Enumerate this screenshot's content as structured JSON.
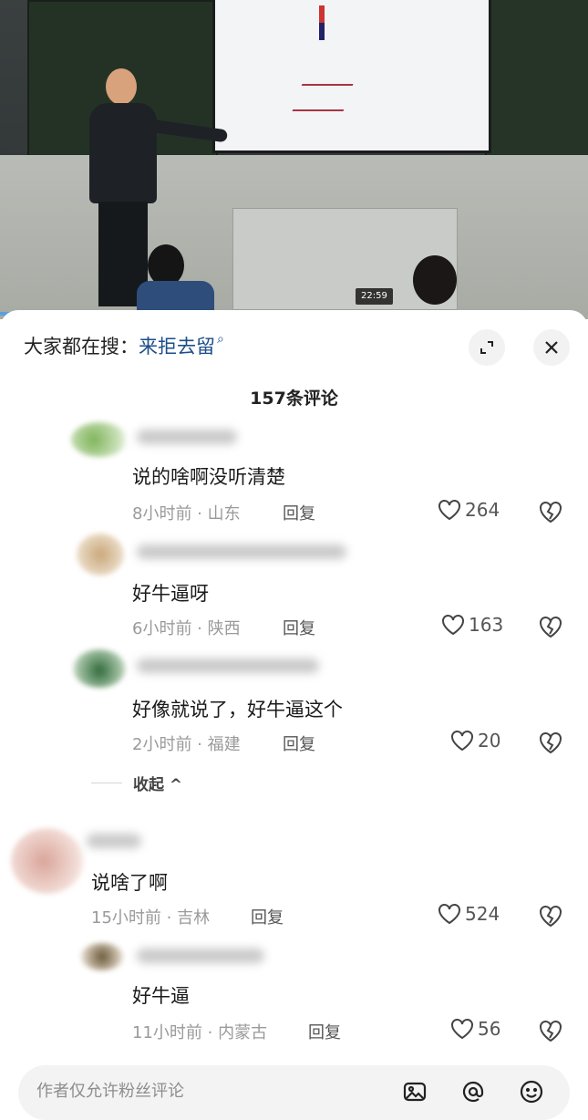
{
  "video": {
    "timestamp": "22:59"
  },
  "sheet": {
    "search_prefix": "大家都在搜：",
    "search_keyword": "来拒去留",
    "comment_count_title": "157条评论",
    "collapse_label": "收起 ^",
    "input_placeholder": "作者仅允许粉丝评论"
  },
  "comments": [
    {
      "text": "说的啥啊没听清楚",
      "meta": "8小时前 · 山东",
      "reply": "回复",
      "likes": "264"
    },
    {
      "text": "好牛逼呀",
      "meta": "6小时前 · 陕西",
      "reply": "回复",
      "likes": "163"
    },
    {
      "text": "好像就说了，好牛逼这个",
      "meta": "2小时前 · 福建",
      "reply": "回复",
      "likes": "20"
    },
    {
      "text": "说啥了啊",
      "meta": "15小时前 · 吉林",
      "reply": "回复",
      "likes": "524"
    },
    {
      "text": "好牛逼",
      "meta": "11小时前 · 内蒙古",
      "reply": "回复",
      "likes": "56"
    }
  ],
  "icons": {
    "search": "magnifier-icon",
    "expand": "expand-icon",
    "close": "close-icon",
    "like": "heart-icon",
    "dislike": "broken-heart-icon",
    "image": "image-icon",
    "mention": "at-icon",
    "emoji": "emoji-icon"
  }
}
